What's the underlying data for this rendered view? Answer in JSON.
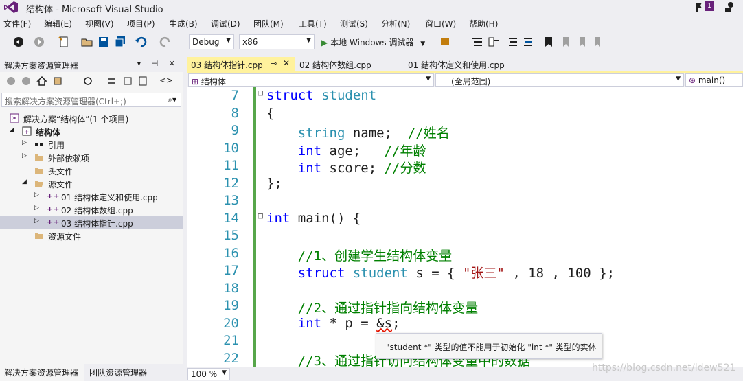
{
  "window": {
    "title": "结构体 - Microsoft Visual Studio",
    "notification_count": "1"
  },
  "menu": [
    "文件(F)",
    "编辑(E)",
    "视图(V)",
    "项目(P)",
    "生成(B)",
    "调试(D)",
    "团队(M)",
    "工具(T)",
    "测试(S)",
    "分析(N)",
    "窗口(W)",
    "帮助(H)"
  ],
  "toolbar": {
    "config": "Debug",
    "platform": "x86",
    "run_label": "本地 Windows 调试器"
  },
  "solution_explorer": {
    "title": "解决方案资源管理器",
    "search_placeholder": "搜索解决方案资源管理器(Ctrl+;)",
    "tree": [
      {
        "label": "解决方案“结构体”(1 个项目)",
        "icon": "solution-icon"
      },
      {
        "label": "结构体",
        "icon": "project-icon"
      },
      {
        "label": "引用",
        "icon": "references-icon"
      },
      {
        "label": "外部依赖项",
        "icon": "folder-icon"
      },
      {
        "label": "头文件",
        "icon": "folder-icon"
      },
      {
        "label": "源文件",
        "icon": "folder-icon"
      },
      {
        "label": "01 结构体定义和使用.cpp",
        "icon": "cpp-file-icon"
      },
      {
        "label": "02 结构体数组.cpp",
        "icon": "cpp-file-icon"
      },
      {
        "label": "03 结构体指针.cpp",
        "icon": "cpp-file-icon"
      },
      {
        "label": "资源文件",
        "icon": "folder-icon"
      }
    ],
    "bottom_tabs": [
      "解决方案资源管理器",
      "团队资源管理器"
    ]
  },
  "documents": {
    "tabs": [
      "03 结构体指针.cpp",
      "02 结构体数组.cpp",
      "01 结构体定义和使用.cpp"
    ],
    "active_index": 0
  },
  "navbar": {
    "project": "结构体",
    "scope": "(全局范围)",
    "member": "main()"
  },
  "editor": {
    "lines": [
      {
        "n": "7",
        "tokens": [
          {
            "t": "struct",
            "c": "kw"
          },
          {
            "t": " ",
            "c": "tx"
          },
          {
            "t": "student",
            "c": "ty"
          }
        ],
        "fold": "⊟",
        "indent": 0
      },
      {
        "n": "8",
        "tokens": [
          {
            "t": "{",
            "c": "tx"
          }
        ],
        "indent": 0
      },
      {
        "n": "9",
        "tokens": [
          {
            "t": "    ",
            "c": "tx"
          },
          {
            "t": "string",
            "c": "ty"
          },
          {
            "t": " name;  ",
            "c": "tx"
          },
          {
            "t": "//姓名",
            "c": "cm"
          }
        ],
        "indent": 0
      },
      {
        "n": "10",
        "tokens": [
          {
            "t": "    ",
            "c": "tx"
          },
          {
            "t": "int",
            "c": "kw"
          },
          {
            "t": " age;   ",
            "c": "tx"
          },
          {
            "t": "//年龄",
            "c": "cm"
          }
        ],
        "indent": 0
      },
      {
        "n": "11",
        "tokens": [
          {
            "t": "    ",
            "c": "tx"
          },
          {
            "t": "int",
            "c": "kw"
          },
          {
            "t": " score; ",
            "c": "tx"
          },
          {
            "t": "//分数",
            "c": "cm"
          }
        ],
        "indent": 0
      },
      {
        "n": "12",
        "tokens": [
          {
            "t": "};",
            "c": "tx"
          }
        ],
        "indent": 0
      },
      {
        "n": "13",
        "tokens": [],
        "indent": 0
      },
      {
        "n": "14",
        "tokens": [
          {
            "t": "int",
            "c": "kw"
          },
          {
            "t": " main() {",
            "c": "tx"
          }
        ],
        "fold": "⊟",
        "indent": 0
      },
      {
        "n": "15",
        "tokens": [],
        "indent": 0
      },
      {
        "n": "16",
        "tokens": [
          {
            "t": "    ",
            "c": "tx"
          },
          {
            "t": "//1、创建学生结构体变量",
            "c": "cm"
          }
        ],
        "indent": 0
      },
      {
        "n": "17",
        "tokens": [
          {
            "t": "    ",
            "c": "tx"
          },
          {
            "t": "struct",
            "c": "kw"
          },
          {
            "t": " ",
            "c": "tx"
          },
          {
            "t": "student",
            "c": "ty"
          },
          {
            "t": " s = { ",
            "c": "tx"
          },
          {
            "t": "\"张三\"",
            "c": "st"
          },
          {
            "t": " , 18 , 100 };",
            "c": "tx"
          }
        ],
        "indent": 0
      },
      {
        "n": "18",
        "tokens": [],
        "indent": 0
      },
      {
        "n": "19",
        "tokens": [
          {
            "t": "    ",
            "c": "tx"
          },
          {
            "t": "//2、通过指针指向结构体变量",
            "c": "cm"
          }
        ],
        "indent": 0
      },
      {
        "n": "20",
        "tokens": [
          {
            "t": "    ",
            "c": "tx"
          },
          {
            "t": "int",
            "c": "kw"
          },
          {
            "t": " * p = ",
            "c": "tx"
          },
          {
            "t": "&s",
            "c": "tx squiggle"
          },
          {
            "t": ";",
            "c": "tx"
          }
        ],
        "indent": 0
      },
      {
        "n": "21",
        "tokens": [],
        "indent": 0
      },
      {
        "n": "22",
        "tokens": [
          {
            "t": "    ",
            "c": "tx"
          },
          {
            "t": "//3、通过指针访问结构体变量中的数据",
            "c": "cm"
          }
        ],
        "indent": 0
      }
    ],
    "tooltip": "\"student *\" 类型的值不能用于初始化 \"int *\" 类型的实体"
  },
  "status": {
    "zoom": "100 %",
    "watermark": "https://blog.csdn.net/ldew521"
  }
}
